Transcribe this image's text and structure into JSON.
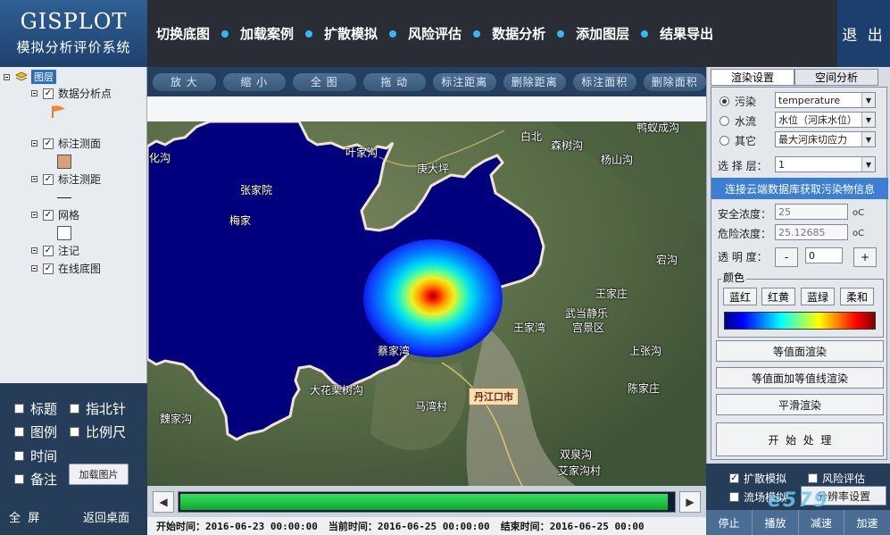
{
  "app": {
    "title_en": "GISPLOT",
    "title_cn": "模拟分析评价系统",
    "exit_label": "退 出"
  },
  "nav": [
    "切换底图",
    "加载案例",
    "扩散模拟",
    "风险评估",
    "数据分析",
    "添加图层",
    "结果导出"
  ],
  "tree": {
    "root_label": "图层",
    "items": [
      "数据分析点",
      "标注测面",
      "标注测距",
      "网格",
      "注记",
      "在线底图"
    ]
  },
  "left_options": {
    "title": "标题",
    "north": "指北针",
    "legend": "图例",
    "scale": "比例尺",
    "time": "时间",
    "note": "备注",
    "load_image": "加载图片",
    "fullscreen": "全  屏",
    "back_desktop": "返回桌面"
  },
  "map_tools": [
    "放  大",
    "缩  小",
    "全  图",
    "拖  动",
    "标注距离",
    "删除距离",
    "标注面积",
    "删除面积"
  ],
  "places": [
    "鸭蚁成沟",
    "白北",
    "叶家沟",
    "庚大坪",
    "森树沟",
    "杨山沟",
    "化沟",
    "张家院",
    "梅家",
    "宕沟",
    "王家庄",
    "武当静乐",
    "宫景区",
    "王家湾",
    "蔡家湾",
    "上张沟",
    "大花栗树沟",
    "马湾村",
    "陈家庄",
    "魏家沟",
    "双泉沟",
    "艾家沟村"
  ],
  "city_label": "丹江口市",
  "timebar": {
    "start_label": "开始时间：",
    "start": "2016-06-23 00:00:00",
    "current_label": "当前时间：",
    "current": "2016-06-25 00:00:00",
    "end_label": "结束时间：",
    "end": "2016-06-25 00:00"
  },
  "progress": 0.99,
  "right_panel": {
    "tab_render": "渲染设置",
    "tab_spatial": "空间分析",
    "radio_pollution": "污染",
    "radio_flow": "水流",
    "radio_other": "其它",
    "sel_pollution": "temperature",
    "sel_flow": "水位（河床水位）",
    "sel_other": "最大河床切应力",
    "layer_label": "选 择 层：",
    "layer_value": "1",
    "cloud_btn": "连接云端数据库获取污染物信息",
    "safe_label": "安全浓度：",
    "safe_value": "25",
    "danger_label": "危险浓度：",
    "danger_value": "25.12685",
    "unit": "oC",
    "opacity_label": "透 明 度：",
    "opacity_minus": "-",
    "opacity_value": "0",
    "opacity_plus": "+",
    "color_title": "颜色",
    "color_buttons": [
      "蓝红",
      "红黄",
      "蓝绿",
      "柔和"
    ],
    "btn_contour": "等值面渲染",
    "btn_contour_line": "等值面加等值线渲染",
    "btn_smooth": "平滑渲染",
    "btn_start": "开  始  处  理"
  },
  "right_bottom": {
    "diffusion": "扩散模拟",
    "risk": "风险评估",
    "flow_sim": "流场模拟",
    "resolution": "分辨率设置",
    "stop": "停止",
    "play": "播放",
    "slow": "减速",
    "fast": "加速"
  },
  "watermark": "e579",
  "colors": {
    "header_bg": "#2a2d35",
    "accent": "#35b8f0",
    "water": "#00007f",
    "panel_bg": "#253d58"
  }
}
